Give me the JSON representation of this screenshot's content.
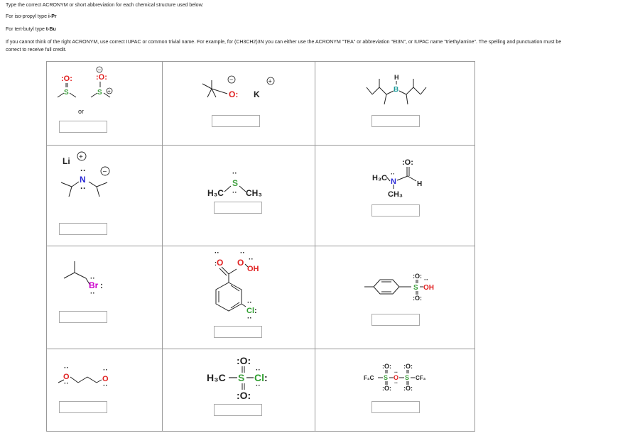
{
  "instructions": {
    "line1": "Type the correct ACRONYM or short abbreviation for each chemical structure used below:",
    "line2_prefix": "For iso-propyl type ",
    "line2_code": "i-Pr",
    "line3_prefix": "For tert-butyl type ",
    "line3_code": "t-Bu",
    "line4": "If you cannot think of the right ACRONYM, use correct IUPAC or common trivial name. For example, for (CH3CH2)3N you can either use the ACRONYM \"TEA\" or abbreviation \"Et3N\", or IUPAC name \"triethylamine\". The spelling and punctuation must be",
    "line5": "correct to receive full credit."
  },
  "structures": {
    "dmso": {
      "O": ":O:",
      "S": "S",
      "or": "or",
      "O2": "O",
      "S2": "S",
      "plus": "+",
      "minus": "−"
    },
    "tbuok": {
      "O": "O",
      "K": "K",
      "plus": "+",
      "minus": "−"
    },
    "boron": {
      "H": "H",
      "B": "B"
    },
    "lda": {
      "Li": "Li",
      "plus": "+",
      "N": "N",
      "minus": "−"
    },
    "dms": {
      "left": "H₃C",
      "S": "S",
      "right": "CH₃"
    },
    "dmf": {
      "O": ":O:",
      "H3C": "H₃C",
      "N": "N",
      "H": "H",
      "CH3": "CH₃"
    },
    "ibr": {
      "Br": "Br"
    },
    "mcpba": {
      "O": "O",
      "OH": "OH",
      "Cl": "Cl"
    },
    "tsoh": {
      "O_top": ":O:",
      "S": "S",
      "OH": "OH",
      "O_bot": ":O:"
    },
    "dme": {
      "O": "O"
    },
    "mscl": {
      "O_top": ":O:",
      "H3C": "H₃C",
      "S": "S",
      "Cl": "Cl",
      "O_bot": ":O:"
    },
    "tf2o": {
      "F3C": "F₃C",
      "S": "S",
      "O": "O",
      "CF3": "CF₃",
      "Otop": ":O:",
      "Obot": ":O:"
    }
  },
  "colors": {
    "sulfur": "#3fa03f",
    "nitrogen": "#2b2bd6",
    "oxygen": "#e02020",
    "boron": "#1b9a9a",
    "bromine": "#cc00cc",
    "chlorine": "#2e9e2e",
    "text": "#222222",
    "border": "#999999"
  },
  "answers": [
    "",
    "",
    "",
    "",
    "",
    "",
    "",
    "",
    "",
    "",
    "",
    ""
  ]
}
